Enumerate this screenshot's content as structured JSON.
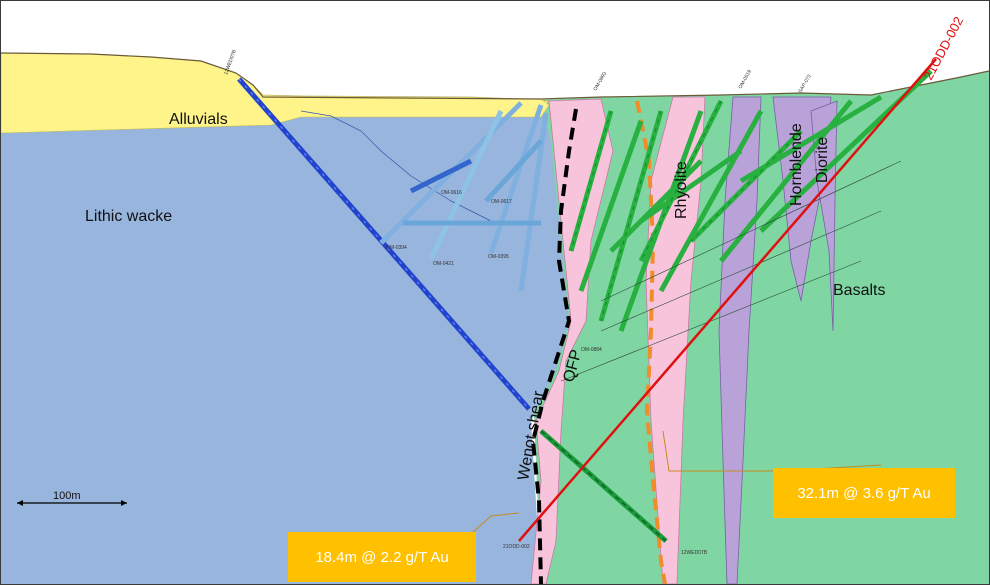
{
  "units": {
    "alluvials": "Alluvials",
    "lithic_wacke": "Lithic wacke",
    "rhyolite": "Rhyolite",
    "hornblende": "Hornblende",
    "diorite": "Diorite",
    "basalts": "Basalts",
    "qfp": "QFP",
    "wenot_shear": "Wenot shear"
  },
  "scale_bar": {
    "label": "100m"
  },
  "drillhole_label": "21ODD-002",
  "intercepts": {
    "right": "32.1m @ 3.6 g/T Au",
    "left": "18.4m @ 2.2 g/T Au"
  },
  "hole_tags": {
    "h1": "12WED07B",
    "h2": "OM-0394",
    "h3": "OM-0421",
    "h4": "OM-0395",
    "h5": "OM-0617",
    "h6": "OM-0616",
    "h7": "OM-0884",
    "h8": "12WED07B",
    "h9": "21ODD-002",
    "h10": "OM-0893",
    "h11": "OM-0519",
    "h12": "SAP-073"
  },
  "colors": {
    "alluvial": "#fef48a",
    "wacke": "#98b5dd",
    "basalt": "#7fd6a2",
    "rhyolite": "#f8c4dc",
    "hornblende": "#b8a2d8",
    "qfp_trace": "#000000",
    "shear_trace": "#f08c2a",
    "main_hole": "#e01010",
    "callout": "#ffc000"
  }
}
